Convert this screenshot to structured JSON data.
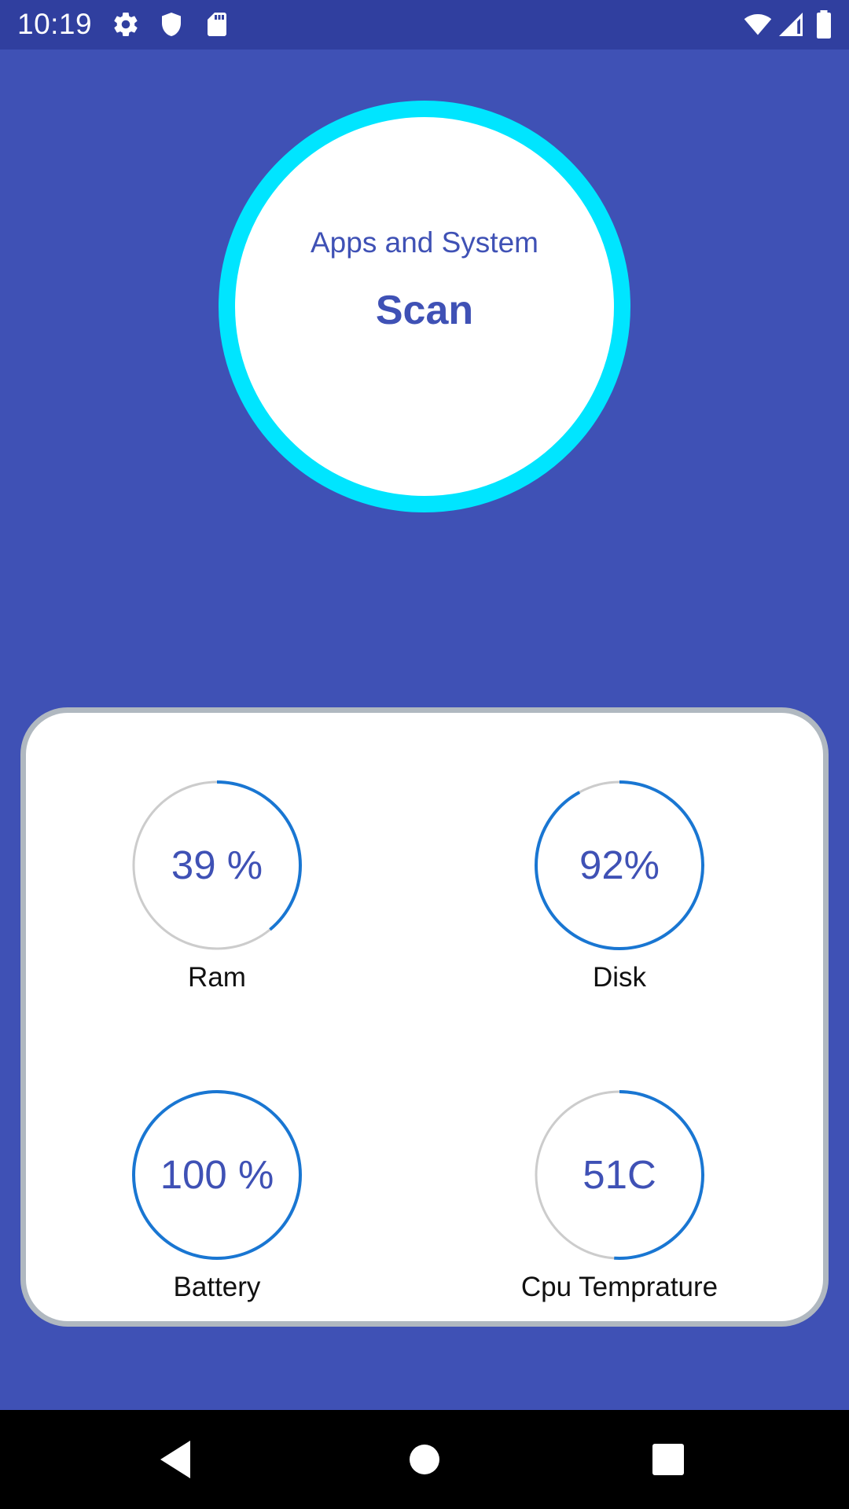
{
  "status_bar": {
    "time": "10:19",
    "left_icons": [
      "gear-icon",
      "shield-icon",
      "sd-card-icon"
    ],
    "right_icons": [
      "wifi-icon",
      "signal-icon",
      "battery-icon"
    ]
  },
  "scan": {
    "subtitle": "Apps and System",
    "title": "Scan"
  },
  "stats": [
    {
      "label": "Ram",
      "value": "39 %",
      "progress": 0.39
    },
    {
      "label": "Disk",
      "value": "92%",
      "progress": 0.92
    },
    {
      "label": "Battery",
      "value": "100 %",
      "progress": 1.0
    },
    {
      "label": "Cpu Temprature",
      "value": "51C",
      "progress": 0.51
    }
  ],
  "nav_bar": {
    "buttons": [
      "back-icon",
      "home-icon",
      "recents-icon"
    ]
  },
  "colors": {
    "background": "#3f51b5",
    "status_bar": "#303f9f",
    "scan_ring": "#00e5ff",
    "gauge_progress": "#1976d2",
    "gauge_track": "#cccccc",
    "value_text": "#3f51b5"
  }
}
